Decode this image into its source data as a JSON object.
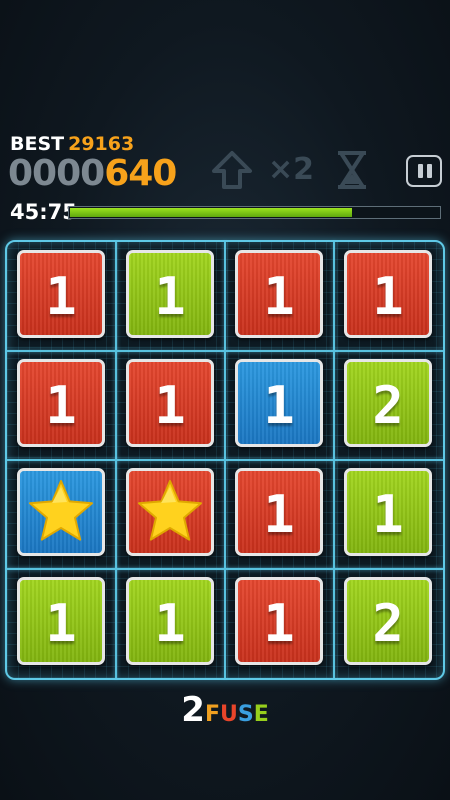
{
  "hud": {
    "best_label": "BEST",
    "best_value": "29163",
    "score_dim": "0000",
    "score_hot": "640",
    "multiplier": "×2",
    "timer": "45:75",
    "time_remaining_fraction": 0.76
  },
  "icons": {
    "arrow": "up-arrow-icon",
    "multiplier": "multiplier-icon",
    "hourglass": "hourglass-icon",
    "pause": "pause-icon",
    "star": "star-icon"
  },
  "board": {
    "rows": [
      [
        {
          "color": "red",
          "value": "1"
        },
        {
          "color": "green",
          "value": "1"
        },
        {
          "color": "red",
          "value": "1"
        },
        {
          "color": "red",
          "value": "1"
        }
      ],
      [
        {
          "color": "red",
          "value": "1"
        },
        {
          "color": "red",
          "value": "1"
        },
        {
          "color": "blue",
          "value": "1"
        },
        {
          "color": "green",
          "value": "2"
        }
      ],
      [
        {
          "color": "blue",
          "value": "star"
        },
        {
          "color": "red",
          "value": "star"
        },
        {
          "color": "red",
          "value": "1"
        },
        {
          "color": "green",
          "value": "1"
        }
      ],
      [
        {
          "color": "green",
          "value": "1"
        },
        {
          "color": "green",
          "value": "1"
        },
        {
          "color": "red",
          "value": "1"
        },
        {
          "color": "green",
          "value": "2"
        }
      ]
    ]
  },
  "logo": {
    "text_two": "2",
    "letters": [
      "F",
      "U",
      "S",
      "E"
    ],
    "letter_colors": [
      "#f0a020",
      "#e8452a",
      "#3a9fe0",
      "#97cf1c"
    ]
  },
  "colors": {
    "accent": "#f7a21b",
    "grid": "#58c1de",
    "red": "#d63a22",
    "green": "#92c517",
    "blue": "#2388d2"
  }
}
